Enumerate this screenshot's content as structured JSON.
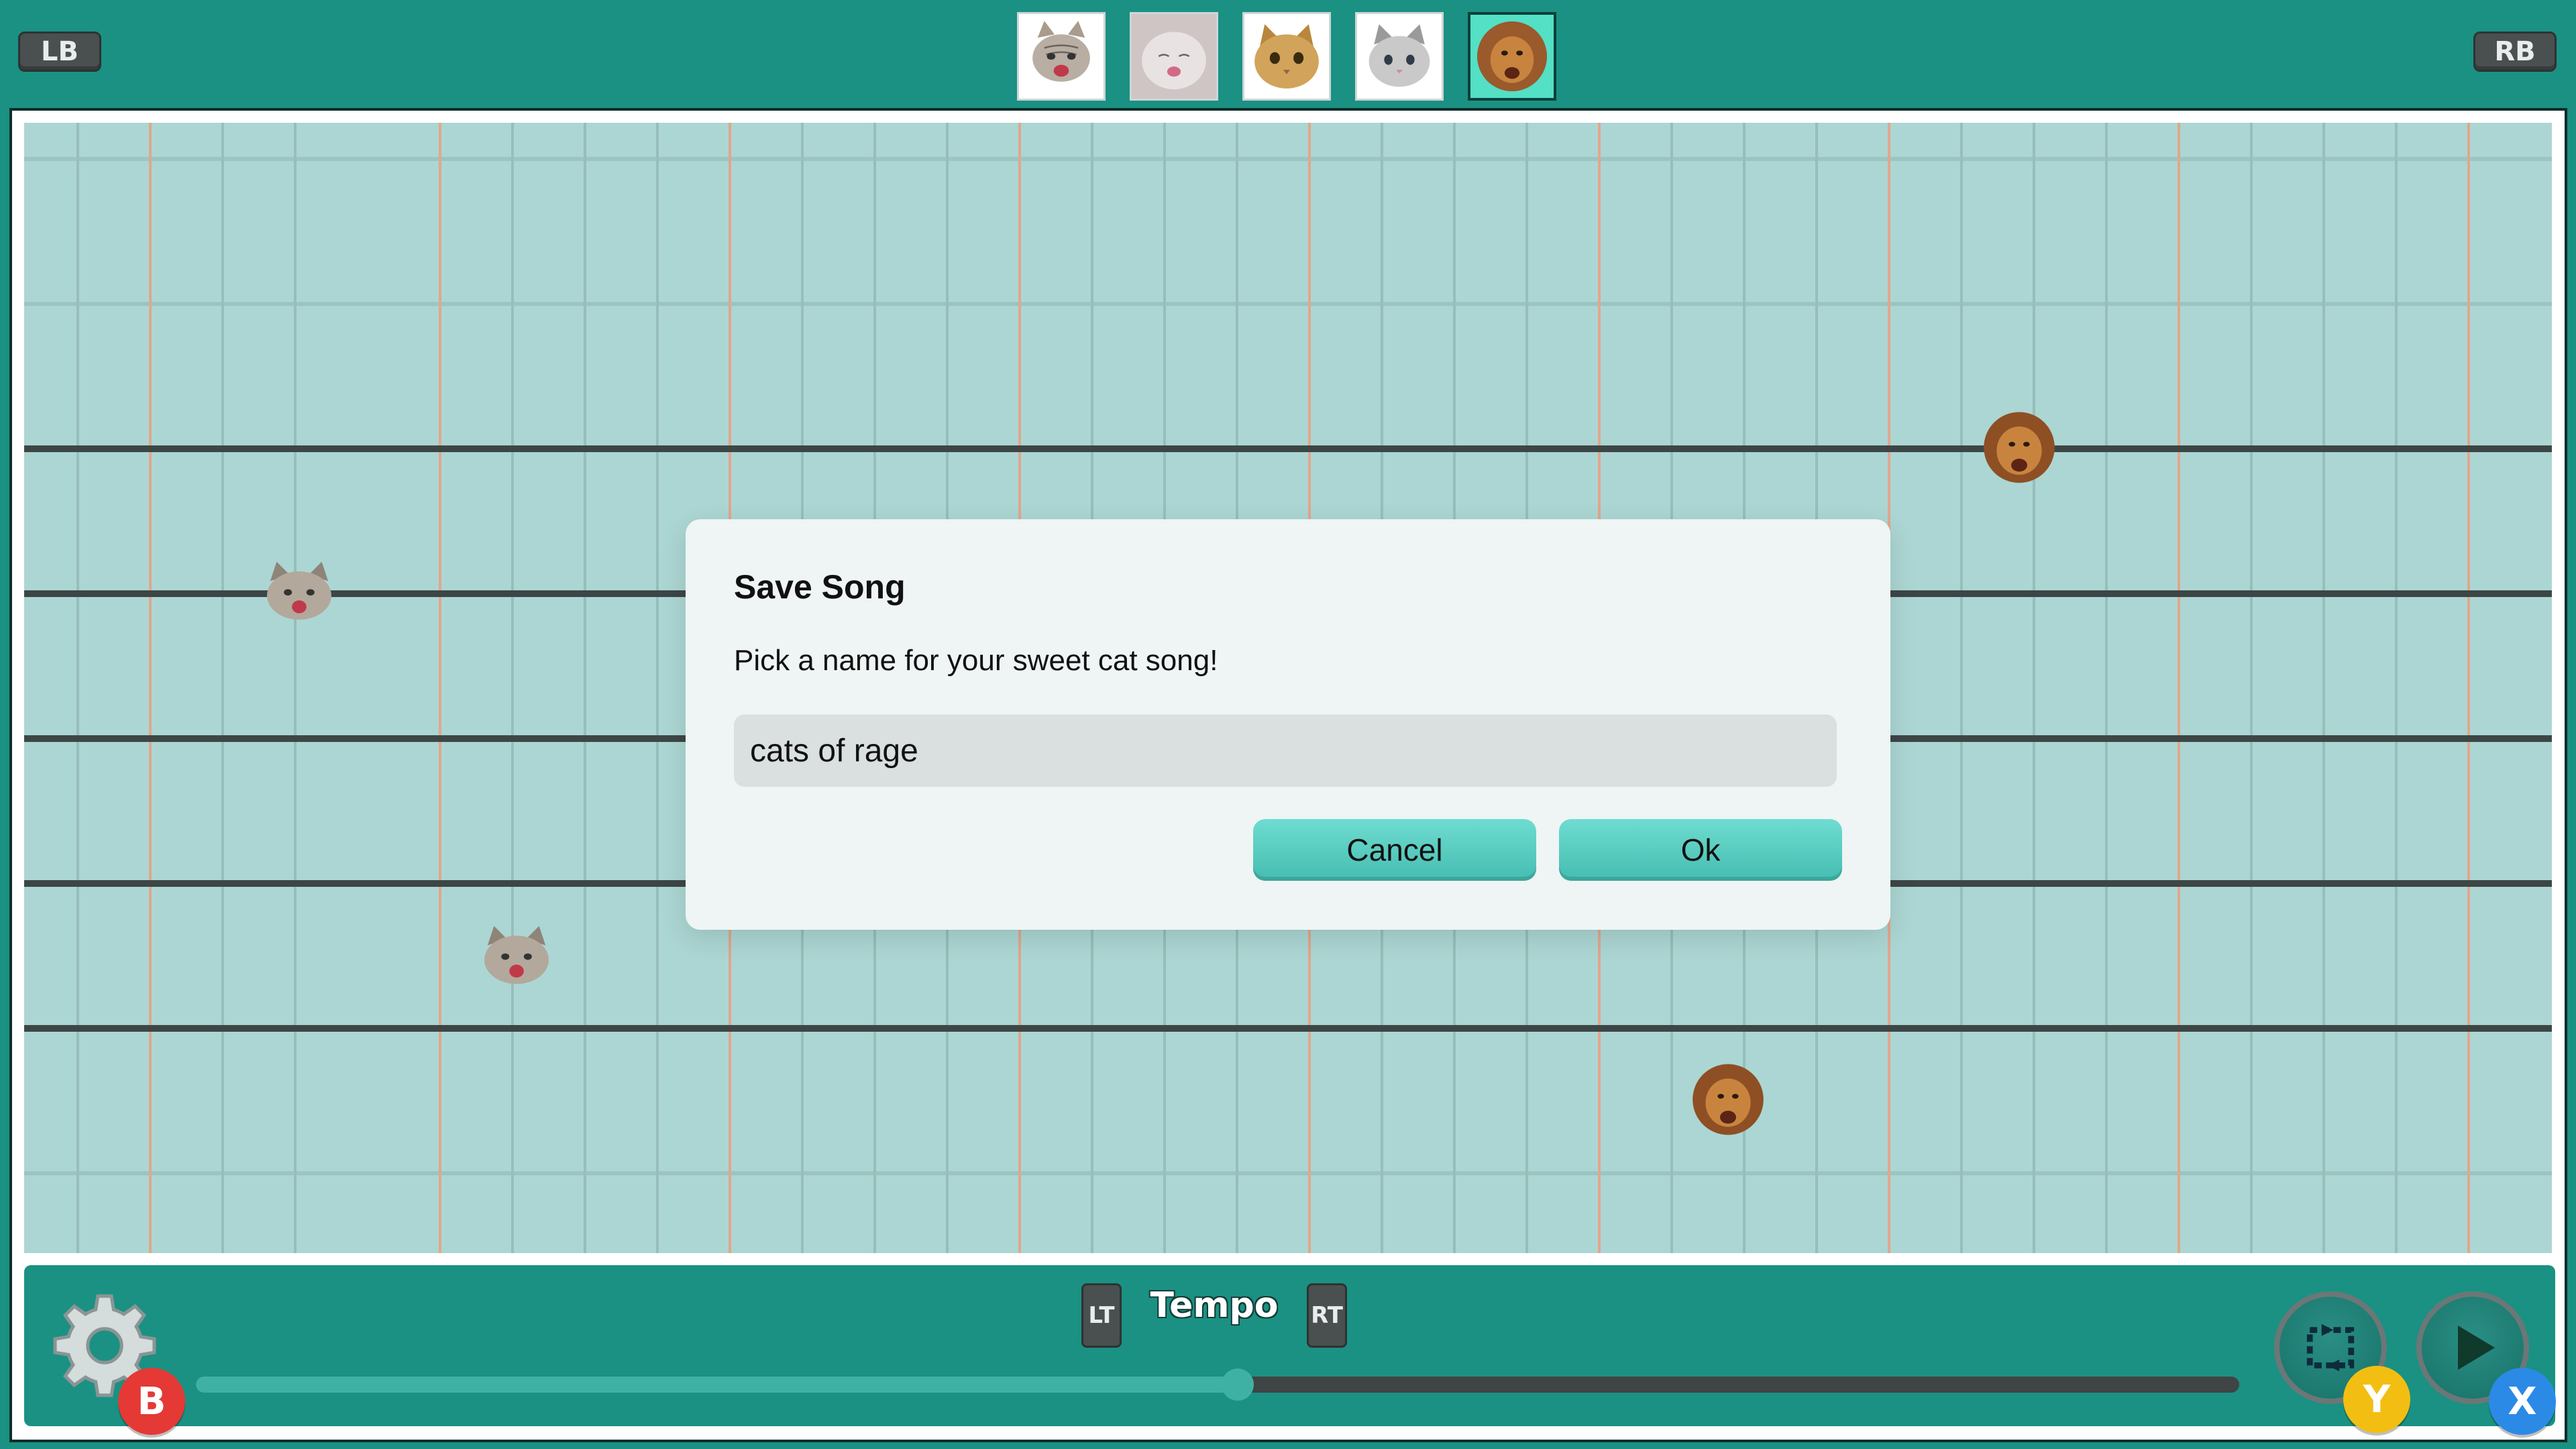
{
  "top_bar": {
    "left_shoulder": "LB",
    "right_shoulder": "RB",
    "animals": [
      {
        "name": "kitten-tabby",
        "icon": "screaming-kitten-icon",
        "selected": false
      },
      {
        "name": "kitten-white",
        "icon": "sleepy-kitten-icon",
        "selected": false
      },
      {
        "name": "kitten-orange",
        "icon": "orange-kitten-icon",
        "selected": false
      },
      {
        "name": "kitten-grey",
        "icon": "grey-kitten-icon",
        "selected": false
      },
      {
        "name": "lion",
        "icon": "lion-icon",
        "selected": true
      }
    ]
  },
  "staff": {
    "notes": [
      {
        "animal": "kitten-tabby",
        "icon": "kitten-note-icon"
      },
      {
        "animal": "kitten-tabby",
        "icon": "kitten-note-icon"
      },
      {
        "animal": "lion",
        "icon": "lion-note-icon"
      },
      {
        "animal": "lion",
        "icon": "lion-note-icon"
      }
    ]
  },
  "dialog": {
    "title": "Save Song",
    "message": "Pick a name for your sweet cat song!",
    "input_value": "cats of rage",
    "cancel_label": "Cancel",
    "ok_label": "Ok"
  },
  "bottom": {
    "settings_icon": "gear-icon",
    "b_button": "B",
    "lt_label": "LT",
    "rt_label": "RT",
    "tempo_label": "Tempo",
    "tempo_value": 0.51,
    "loop_icon": "loop-icon",
    "play_icon": "play-icon",
    "y_button": "Y",
    "x_button": "X"
  },
  "colors": {
    "teal": "#1a9183",
    "staff_bg": "#acd6d3",
    "accent": "#53e0c5",
    "beat_line": "#e0a78e",
    "staff_line": "#3d4646"
  }
}
